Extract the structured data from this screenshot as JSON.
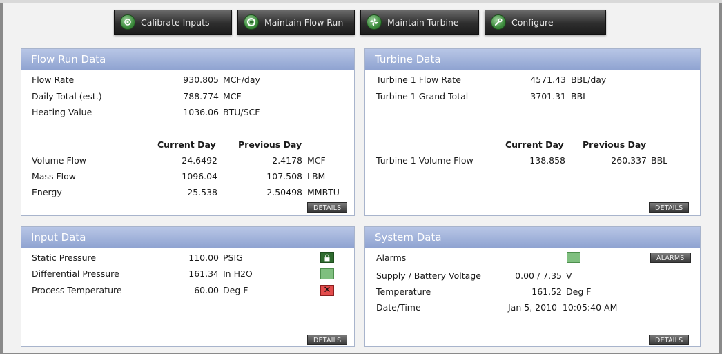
{
  "toolbar": {
    "calibrate": "Calibrate Inputs",
    "maintain_flow": "Maintain Flow Run",
    "maintain_turbine": "Maintain Turbine",
    "configure": "Configure"
  },
  "flow_run": {
    "title": "Flow Run Data",
    "rows": [
      {
        "label": "Flow Rate",
        "value": "930.805",
        "unit": "MCF/day"
      },
      {
        "label": "Daily Total (est.)",
        "value": "788.774",
        "unit": "MCF"
      },
      {
        "label": "Heating Value",
        "value": "1036.06",
        "unit": "BTU/SCF"
      }
    ],
    "col_current": "Current Day",
    "col_previous": "Previous Day",
    "table": [
      {
        "label": "Volume Flow",
        "current": "24.6492",
        "previous": "2.4178",
        "unit": "MCF"
      },
      {
        "label": "Mass Flow",
        "current": "1096.04",
        "previous": "107.508",
        "unit": "LBM"
      },
      {
        "label": "Energy",
        "current": "25.538",
        "previous": "2.50498",
        "unit": "MMBTU"
      }
    ],
    "details": "DETAILS"
  },
  "turbine": {
    "title": "Turbine Data",
    "rows": [
      {
        "label": "Turbine 1 Flow Rate",
        "value": "4571.43",
        "unit": "BBL/day"
      },
      {
        "label": "Turbine 1 Grand Total",
        "value": "3701.31",
        "unit": "BBL"
      }
    ],
    "col_current": "Current Day",
    "col_previous": "Previous Day",
    "table": [
      {
        "label": "Turbine 1 Volume Flow",
        "current": "138.858",
        "previous": "260.337",
        "unit": "BBL"
      }
    ],
    "details": "DETAILS"
  },
  "input": {
    "title": "Input Data",
    "rows": [
      {
        "label": "Static Pressure",
        "value": "110.00",
        "unit": "PSIG",
        "status": "lock-icon"
      },
      {
        "label": "Differential Pressure",
        "value": "161.34",
        "unit": "In H2O",
        "status": "ok"
      },
      {
        "label": "Process Temperature",
        "value": "60.00",
        "unit": "Deg F",
        "status": "error-x"
      }
    ],
    "details": "DETAILS"
  },
  "system": {
    "title": "System Data",
    "alarms_label": "Alarms",
    "alarms_button": "ALARMS",
    "supply_label": "Supply / Battery Voltage",
    "supply_value": "0.00 / 7.35",
    "supply_unit": "V",
    "temp_label": "Temperature",
    "temp_value": "161.52",
    "temp_unit": "Deg F",
    "datetime_label": "Date/Time",
    "datetime_value": "Jan 5, 2010  10:05:40 AM",
    "details": "DETAILS"
  },
  "colors": {
    "panel_header": "#8fa3d1",
    "ok_green": "#7fbf7f",
    "error_red": "#e34c4c"
  }
}
